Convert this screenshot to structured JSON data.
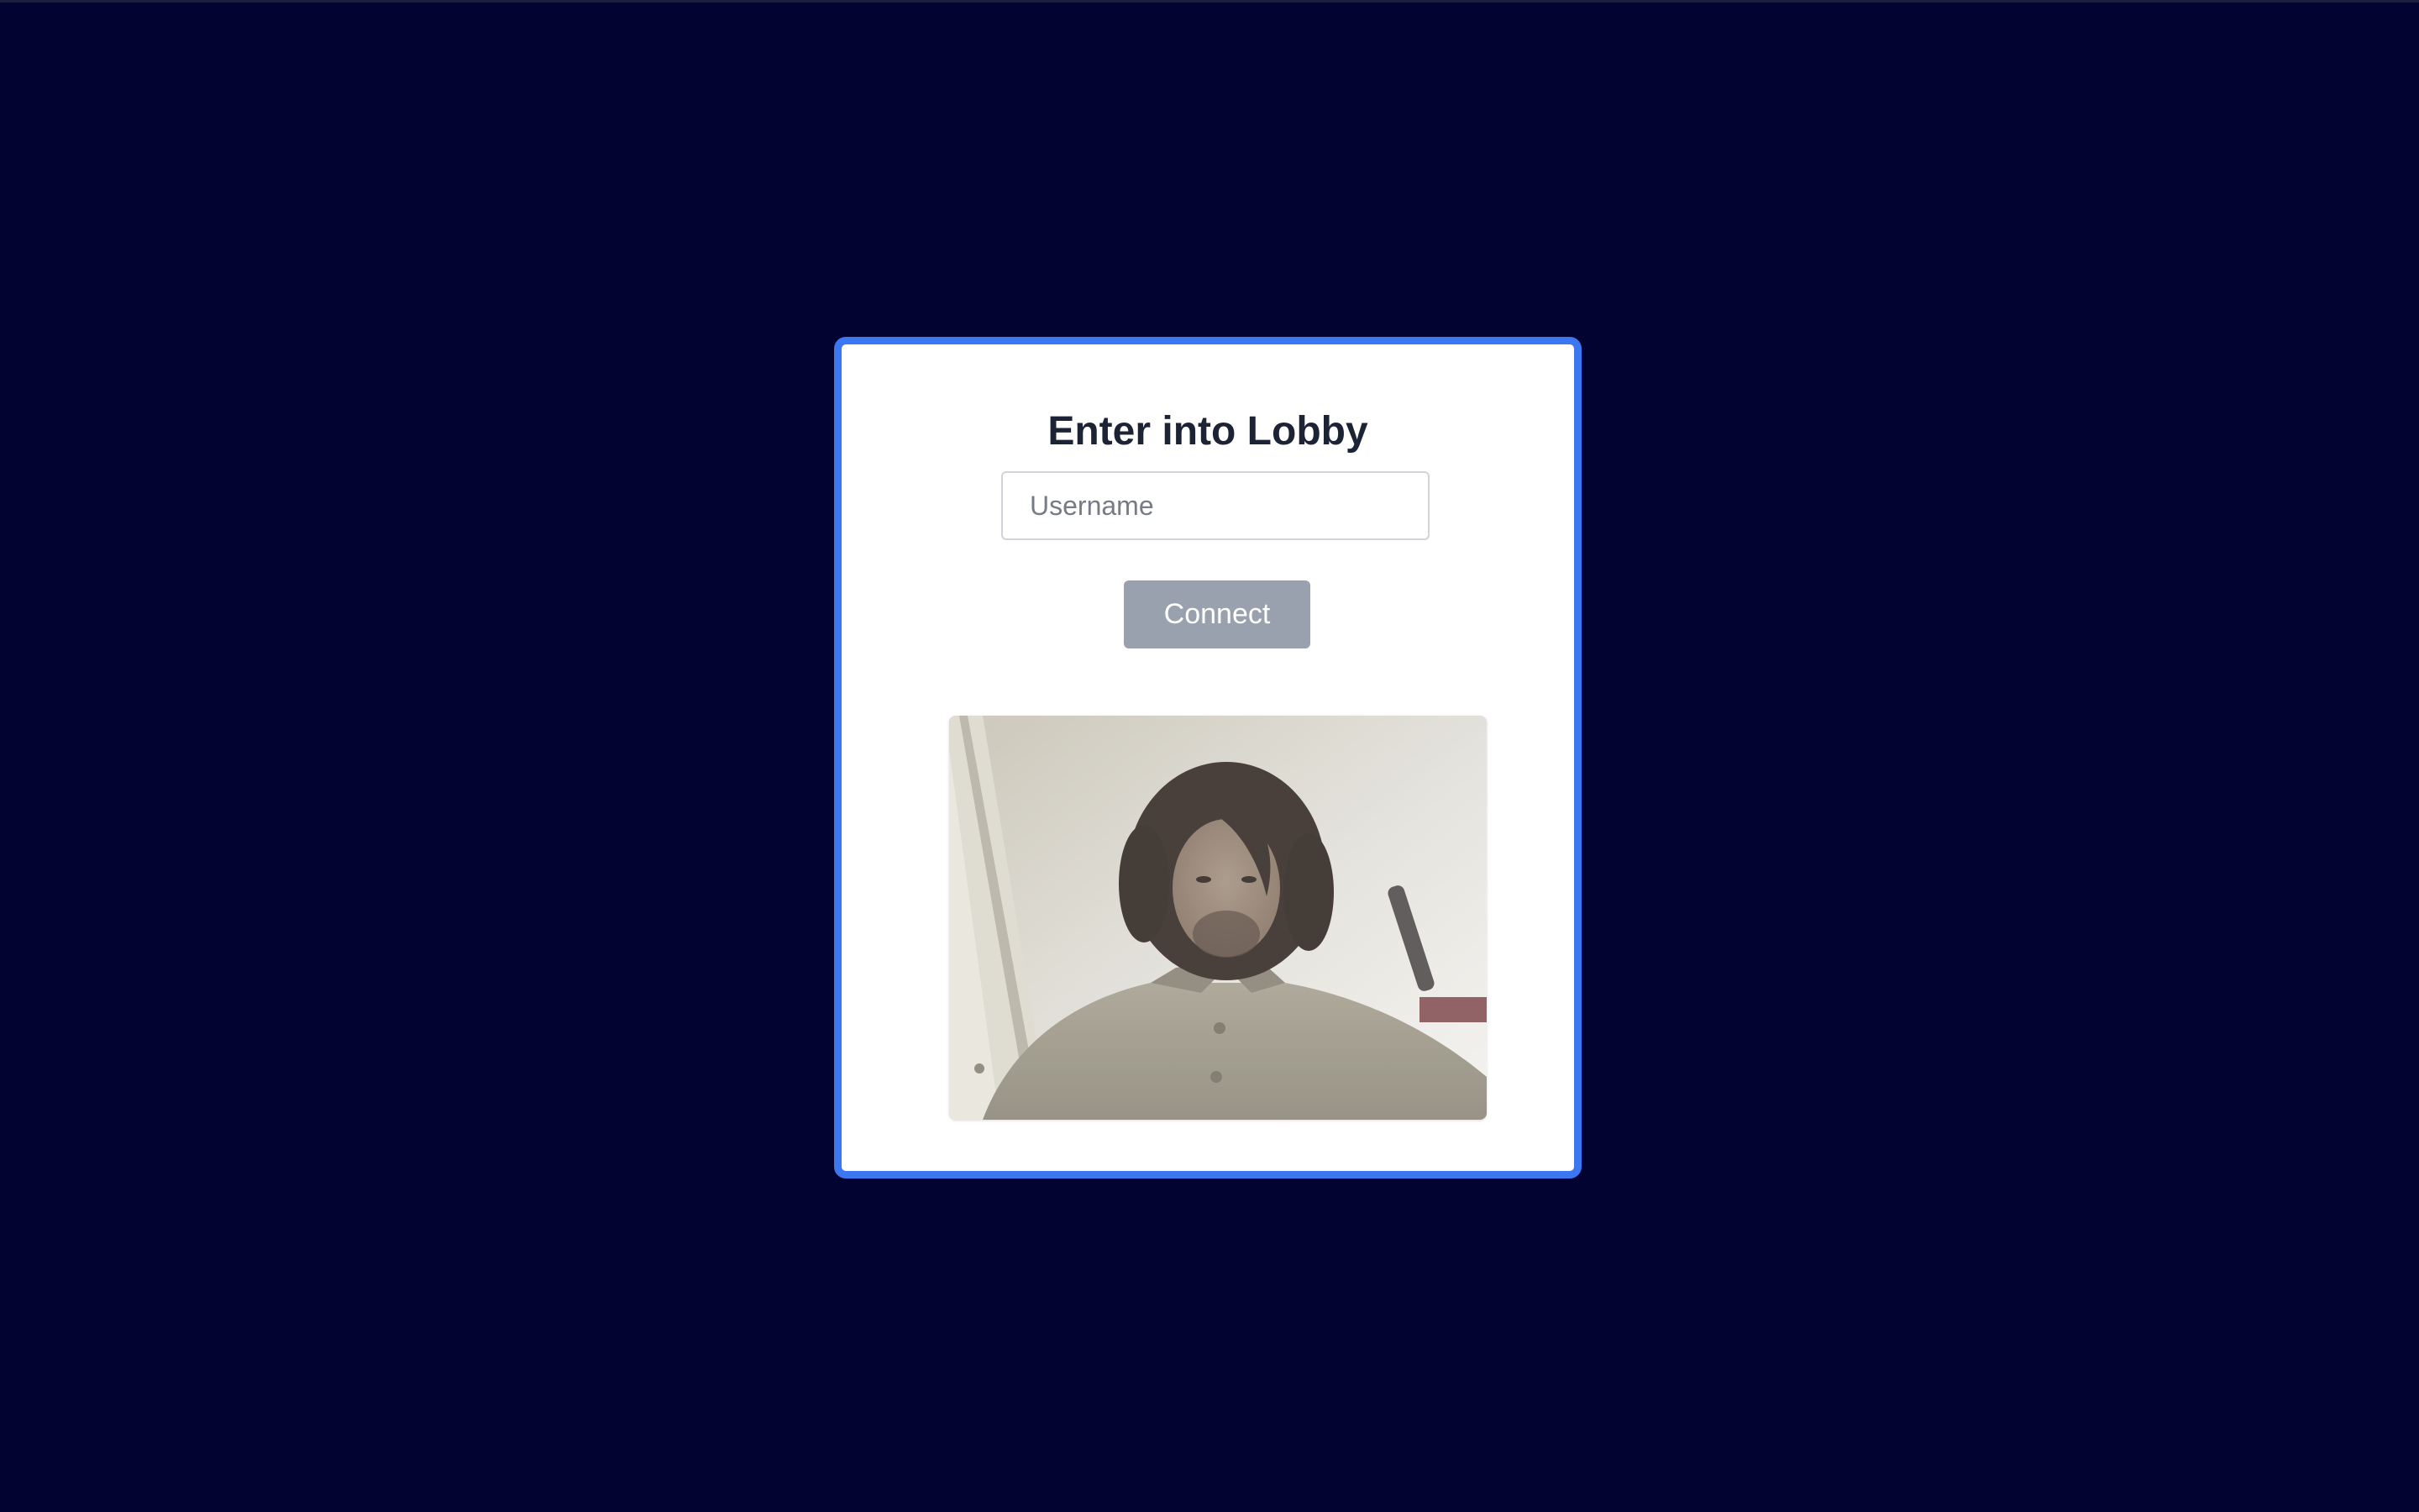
{
  "lobby": {
    "title": "Enter into Lobby",
    "username_placeholder": "Username",
    "username_value": "",
    "connect_label": "Connect"
  },
  "camera_preview": {
    "icon": "webcam-video-feed"
  },
  "colors": {
    "page_background": "#020330",
    "card_border": "#3c76f0",
    "title_text": "#1b2335",
    "connect_button": "#9aa1ae"
  }
}
